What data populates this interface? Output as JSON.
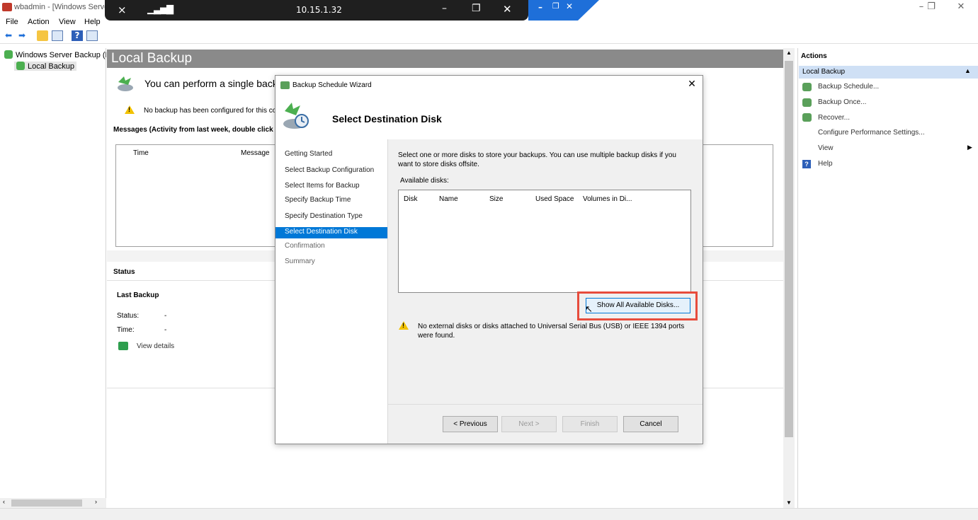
{
  "window": {
    "title": "wbadmin - [Windows Server Backup (Local)\\Local Backup]",
    "minimize": "–",
    "maximize": "❐",
    "close": "✕"
  },
  "menu": [
    "File",
    "Action",
    "View",
    "Help"
  ],
  "rdp": {
    "host": "10.15.1.32",
    "minimize": "–",
    "restore": "❐",
    "close": "✕",
    "pin_icon": "pin-icon",
    "signal_icon": "signal-bars-icon"
  },
  "tree": {
    "root": "Windows Server Backup (Local)",
    "child": "Local Backup"
  },
  "center": {
    "title": "Local Backup",
    "banner": "You can perform a single backup or schedule a regular backup using this application.",
    "warning": "No backup has been configured for this computer. Use the Backup Schedule Wizard or the Backup Once Wizard to perform a regular or one-time backup.",
    "messages_header": "Messages (Activity from last week, double click on the message to see details)",
    "col_time": "Time",
    "col_message": "Message",
    "status_header": "Status",
    "last_backup": "Last Backup",
    "status_label": "Status:",
    "status_value": "-",
    "time_label": "Time:",
    "time_value": "-",
    "view_details": "View details"
  },
  "actions": {
    "header": "Actions",
    "section": "Local Backup",
    "items": [
      "Backup Schedule...",
      "Backup Once...",
      "Recover...",
      "Configure Performance Settings...",
      "View",
      "Help"
    ]
  },
  "dialog": {
    "title": "Backup Schedule Wizard",
    "close": "✕",
    "heading": "Select Destination Disk",
    "steps": [
      "Getting Started",
      "Select Backup Configuration",
      "Select Items for Backup",
      "Specify Backup Time",
      "Specify Destination Type",
      "Select Destination Disk",
      "Confirmation",
      "Summary"
    ],
    "selected_step": "Select Destination Disk",
    "description": "Select one or more disks to store your backups. You can use multiple backup disks if you want to store disks offsite.",
    "available_label": "Available disks:",
    "columns": [
      "Disk",
      "Name",
      "Size",
      "Used Space",
      "Volumes in Di..."
    ],
    "show_all_button": "Show All Available Disks...",
    "warning": "No external disks or disks attached to Universal Serial Bus (USB) or IEEE 1394 ports were found.",
    "buttons": {
      "previous": "< Previous",
      "next": "Next >",
      "finish": "Finish",
      "cancel": "Cancel"
    }
  },
  "colors": {
    "accent": "#0078d7",
    "highlight": "#e74c3c",
    "header_gray": "#8a8a8a",
    "selection": "#cfe0f5",
    "rdp_bar": "#1f1f1f"
  }
}
